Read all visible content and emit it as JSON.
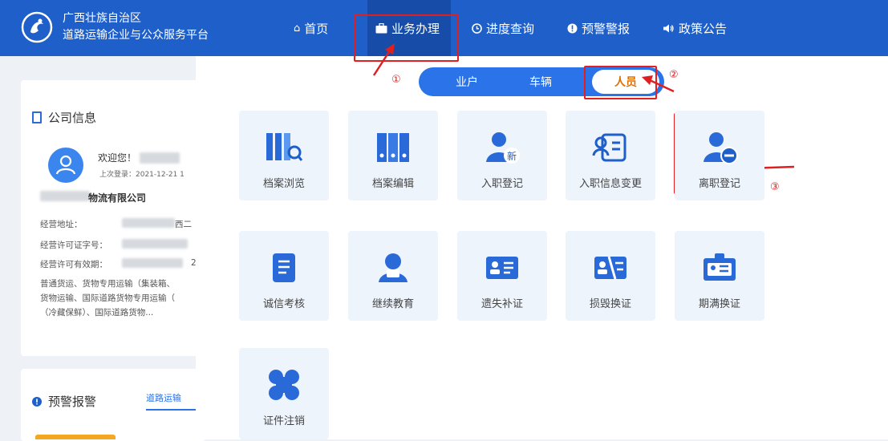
{
  "header": {
    "brand_line1": "广西壮族自治区",
    "brand_line2": "道路运输企业与公众服务平台",
    "nav": [
      {
        "label": "首页",
        "icon": "home-icon"
      },
      {
        "label": "业务办理",
        "icon": "briefcase-icon"
      },
      {
        "label": "进度查询",
        "icon": "clock-icon"
      },
      {
        "label": "预警警报",
        "icon": "alert-icon"
      },
      {
        "label": "政策公告",
        "icon": "speaker-icon"
      }
    ]
  },
  "annotations": {
    "n1": "①",
    "n2": "②",
    "n3": "③"
  },
  "company": {
    "section_title": "公司信息",
    "welcome": "欢迎您！",
    "last_login": "上次登录：2021-12-21 1",
    "name_suffix": "物流有限公司",
    "address_label": "经营地址：",
    "address_tail": "西二",
    "license_label": "经营许可证字号：",
    "valid_label": "经营许可有效期：",
    "valid_tail": "2",
    "scope": [
      "普通货运、货物专用运输（集装箱、",
      "货物运输、国际道路货物专用运输（",
      "（冷藏保鲜）、国际道路货物..."
    ]
  },
  "warning": {
    "title": "预警报警",
    "tab": "道路运输"
  },
  "tabs": [
    {
      "label": "业户",
      "active": false
    },
    {
      "label": "车辆",
      "active": false
    },
    {
      "label": "人员",
      "active": true
    }
  ],
  "tiles": [
    {
      "label": "档案浏览",
      "icon": "archive-browse-icon"
    },
    {
      "label": "档案编辑",
      "icon": "archive-edit-icon"
    },
    {
      "label": "入职登记",
      "icon": "onboard-icon"
    },
    {
      "label": "入职信息变更",
      "icon": "onboard-change-icon"
    },
    {
      "label": "离职登记",
      "icon": "resign-icon"
    },
    {
      "label": "诚信考核",
      "icon": "credit-icon"
    },
    {
      "label": "继续教育",
      "icon": "education-icon"
    },
    {
      "label": "遗失补证",
      "icon": "lost-card-icon"
    },
    {
      "label": "损毁换证",
      "icon": "damaged-card-icon"
    },
    {
      "label": "期满换证",
      "icon": "expired-card-icon"
    },
    {
      "label": "证件注销",
      "icon": "cancel-card-icon"
    }
  ],
  "colors": {
    "primary": "#1f5fc9",
    "accent": "#2a73e8",
    "annotation": "#e02020",
    "active_tab_text": "#e07000"
  }
}
